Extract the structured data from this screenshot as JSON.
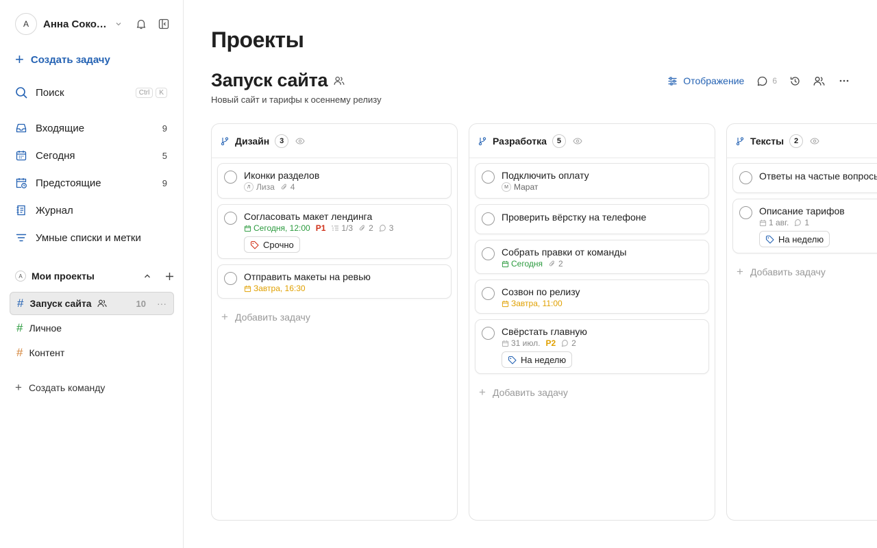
{
  "sidebar": {
    "user": {
      "initial": "А",
      "name": "Анна Сокол..."
    },
    "create_task": "Создать задачу",
    "search": {
      "label": "Поиск",
      "kbd1": "Ctrl",
      "kbd2": "K"
    },
    "nav": [
      {
        "label": "Входящие",
        "count": "9",
        "icon": "inbox-icon"
      },
      {
        "label": "Сегодня",
        "count": "5",
        "icon": "calendar-icon"
      },
      {
        "label": "Предстоящие",
        "count": "9",
        "icon": "calendar-clock-icon"
      },
      {
        "label": "Журнал",
        "count": "",
        "icon": "journal-icon"
      },
      {
        "label": "Умные списки и метки",
        "count": "",
        "icon": "filter-icon"
      }
    ],
    "projects_header": {
      "initial": "А",
      "label": "Мои проекты"
    },
    "projects": [
      {
        "label": "Запуск сайта",
        "count": "10",
        "color": "#2a9a3d"
      },
      {
        "label": "Личное",
        "count": "",
        "color": "#2a9a3d"
      },
      {
        "label": "Контент",
        "count": "",
        "color": "#d4843a"
      }
    ],
    "create_team": "Создать команду"
  },
  "main": {
    "page_title": "Проекты",
    "project_title": "Запуск сайта",
    "project_desc": "Новый сайт и тарифы к осеннему релизу",
    "toolbar": {
      "view_label": "Отображение",
      "comments_count": "6"
    },
    "columns": [
      {
        "title": "Дизайн",
        "count": "3",
        "tasks": [
          {
            "title": "Иконки разделов",
            "assignee_initial": "Л",
            "assignee": "Лиза",
            "attachments": "4"
          },
          {
            "title": "Согласовать макет лендинга",
            "date": "Сегодня, 12:00",
            "priority": "P1",
            "subtasks": "1/3",
            "attachments": "2",
            "comments": "3",
            "tag": "Срочно"
          },
          {
            "title": "Отправить макеты на ревью",
            "date": "Завтра, 16:30"
          }
        ],
        "add_label": "Добавить задачу"
      },
      {
        "title": "Разработка",
        "count": "5",
        "tasks": [
          {
            "title": "Подключить оплату",
            "assignee_initial": "М",
            "assignee": "Марат"
          },
          {
            "title": "Проверить вёрстку на телефоне"
          },
          {
            "title": "Собрать правки от команды",
            "date": "Сегодня",
            "attachments": "2"
          },
          {
            "title": "Созвон по релизу",
            "date": "Завтра, 11:00"
          },
          {
            "title": "Свёрстать главную",
            "date": "31 июл.",
            "priority": "P2",
            "comments": "2",
            "tag": "На неделю"
          }
        ],
        "add_label": "Добавить задачу"
      },
      {
        "title": "Тексты",
        "count": "2",
        "tasks": [
          {
            "title": "Ответы на частые вопросы"
          },
          {
            "title": "Описание тарифов",
            "date": "1 авг.",
            "comments": "1",
            "tag": "На неделю"
          }
        ],
        "add_label": "Добавить задачу"
      }
    ]
  }
}
